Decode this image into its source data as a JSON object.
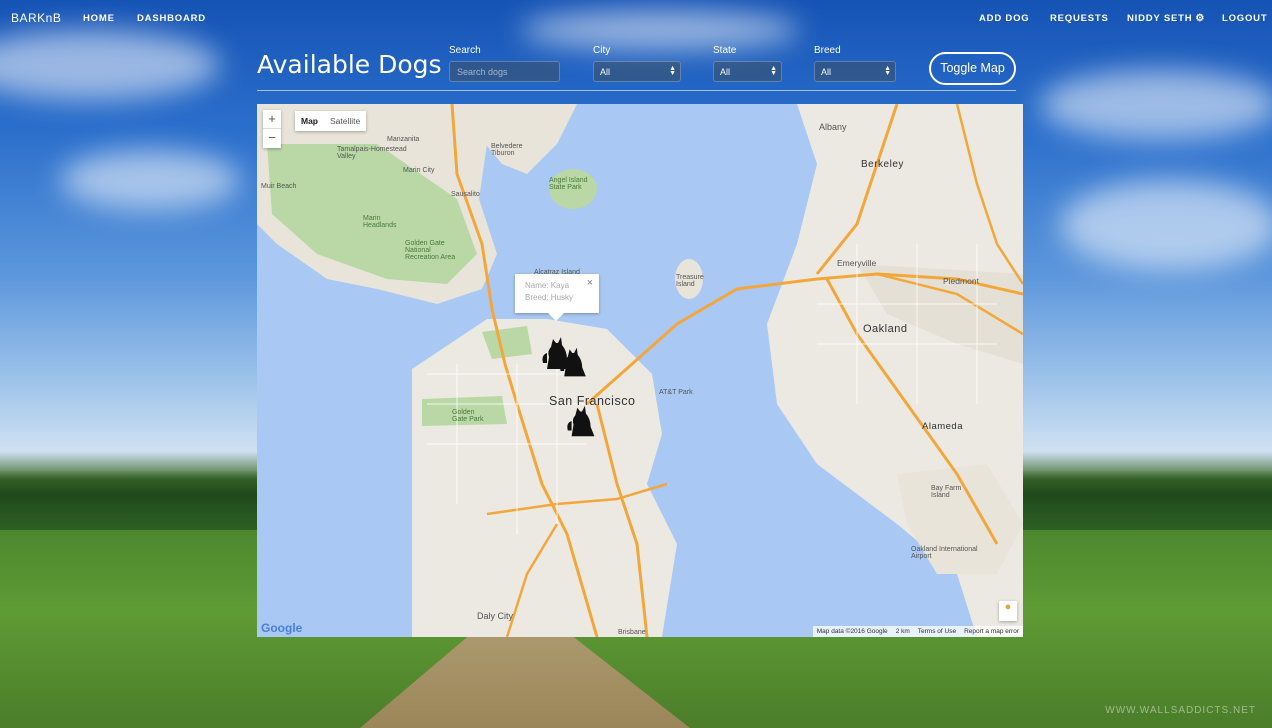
{
  "nav": {
    "brand": "BARKnB",
    "home": "HOME",
    "dashboard": "DASHBOARD",
    "add_dog": "ADD DOG",
    "requests": "REQUESTS",
    "user": "NIDDY SETH",
    "logout": "LOGOUT"
  },
  "header": {
    "title": "Available Dogs",
    "search_label": "Search",
    "search_placeholder": "Search dogs",
    "city_label": "City",
    "city_value": "All",
    "state_label": "State",
    "state_value": "All",
    "breed_label": "Breed",
    "breed_value": "All",
    "toggle_map": "Toggle Map"
  },
  "map": {
    "zoom_in": "+",
    "zoom_out": "−",
    "type_map": "Map",
    "type_satellite": "Satellite",
    "info_name": "Name: Kaya",
    "info_breed": "Breed: Husky",
    "close": "×",
    "google": "Google",
    "attribution": "Map data ©2016 Google",
    "scale": "2 km",
    "terms": "Terms of Use",
    "report": "Report a map error",
    "city_sf": "San Francisco",
    "city_oakland": "Oakland",
    "city_berkeley": "Berkeley",
    "city_alameda": "Alameda",
    "labels": {
      "albany": "Albany",
      "sausalito": "Sausalito",
      "emeryville": "Emeryville",
      "daly_city": "Daly City",
      "piedmont": "Piedmont",
      "bay_farm": "Bay Farm Island",
      "marin_headlands": "Marin Headlands",
      "mill_valley": "Tamalpais-Homestead Valley",
      "tiburon": "Belvedere Tiburon",
      "angel_island": "Angel Island State Park",
      "golden_gate_park": "Golden Gate Park",
      "ggnra": "Golden Gate National Recreation Area",
      "oakland_airport": "Oakland International Airport",
      "brisbane": "Brisbane",
      "muir_beach": "Muir Beach",
      "marin_city": "Marin City",
      "manzanita": "Manzanita",
      "alcatraz": "Alcatraz Island",
      "treasure_island": "Treasure Island",
      "att_park": "AT&T Park"
    }
  },
  "watermark": "WWW.WALLSADDICTS.NET",
  "icons": {
    "gear": "gear-icon",
    "dog_marker": "dog-marker-icon",
    "pegman": "pegman-icon"
  }
}
